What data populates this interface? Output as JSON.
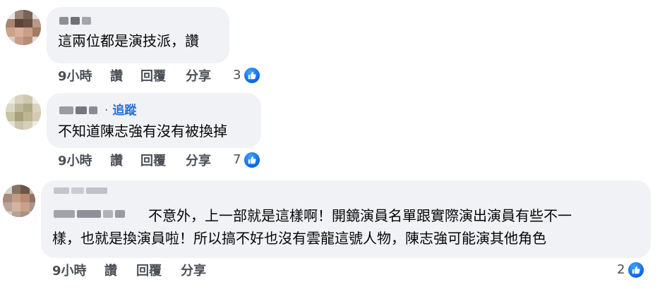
{
  "theme": {
    "bubble_bg": "#f0f2f5",
    "meta_color": "#4b4f56",
    "follow_color": "#216fdb",
    "like_blue": "#1877f2"
  },
  "comments": [
    {
      "text": "這兩位都是演技派，讚",
      "time": "9小時",
      "like": "讚",
      "reply": "回覆",
      "share": "分享",
      "reaction_count": "3",
      "reaction_icon": "like-thumb-icon"
    },
    {
      "follow": "追蹤",
      "separator": "·",
      "text": "不知道陳志強有沒有被換掉",
      "time": "9小時",
      "like": "讚",
      "reply": "回覆",
      "share": "分享",
      "reaction_count": "7",
      "reaction_icon": "like-thumb-icon"
    },
    {
      "text_line1": "不意外，上一部就是這樣啊！開鏡演員名單跟實際演出演員有些不一",
      "text_line2": "樣，也就是換演員啦！所以搞不好也沒有雲龍這號人物，陳志強可能演其他角色",
      "time": "9小時",
      "like": "讚",
      "reply": "回覆",
      "share": "分享",
      "reaction_count": "2",
      "reaction_icon": "like-thumb-icon"
    }
  ]
}
